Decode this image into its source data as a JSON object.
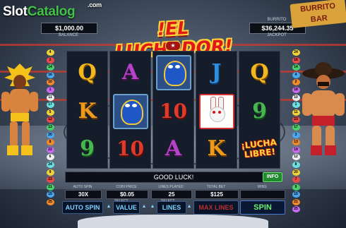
{
  "brand": {
    "slot": "Slot",
    "catalog": "Catalog",
    "dotcom": ".com"
  },
  "balance": {
    "value": "$1,000.00",
    "label": "BALANCE"
  },
  "jackpot": {
    "top_label": "BURRITO",
    "value": "$36,244.35",
    "label": "JACKPOT"
  },
  "game_title": "!EL LUCHADOR!",
  "burrito_sign": {
    "line1": "BURRITO",
    "line2": "BAR"
  },
  "reels": [
    [
      "Q",
      "K",
      "9"
    ],
    [
      "A",
      "mask",
      "10"
    ],
    [
      "mask",
      "10",
      "A"
    ],
    [
      "J",
      "rabbit",
      "K"
    ],
    [
      "Q",
      "9",
      "lucha"
    ]
  ],
  "lucha_text": {
    "line1": "¡LUCHA",
    "line2": "LIBRE!"
  },
  "status_message": "GOOD LUCK!",
  "info_label": "INFO",
  "fields": {
    "auto_spin": {
      "label": "AUTO SPIN",
      "value": "30X"
    },
    "coin_price": {
      "label": "COIN PRICE",
      "value": "$0.05"
    },
    "lines_played": {
      "label": "LINES PLAYED",
      "value": "25"
    },
    "total_bet": {
      "label": "TOTAL BET",
      "value": "$125"
    },
    "wins": {
      "label": "WINS",
      "value": ""
    }
  },
  "controls": {
    "auto_spin": "AUTO SPIN",
    "select": "SELECT",
    "value": "VALUE",
    "lines": "LINES",
    "max_lines": "MAX LINES",
    "spin": "SPIN"
  },
  "paylines_left": [
    "4",
    "2",
    "14",
    "16",
    "10",
    "1",
    "11",
    "17",
    "5",
    "12",
    "13",
    "20",
    "8",
    "22",
    "6",
    "24",
    "9",
    "23",
    "21",
    "15",
    "25"
  ],
  "paylines_right": [
    "24",
    "16",
    "14",
    "4",
    "2",
    "18",
    "10",
    "1",
    "11",
    "23",
    "17",
    "3",
    "13",
    "19",
    "12",
    "8",
    "20",
    "7",
    "9",
    "15",
    "21",
    "25"
  ],
  "colors": {
    "accent": "#1f8a2e",
    "title": "#e01818",
    "gold": "#ffd43a"
  }
}
